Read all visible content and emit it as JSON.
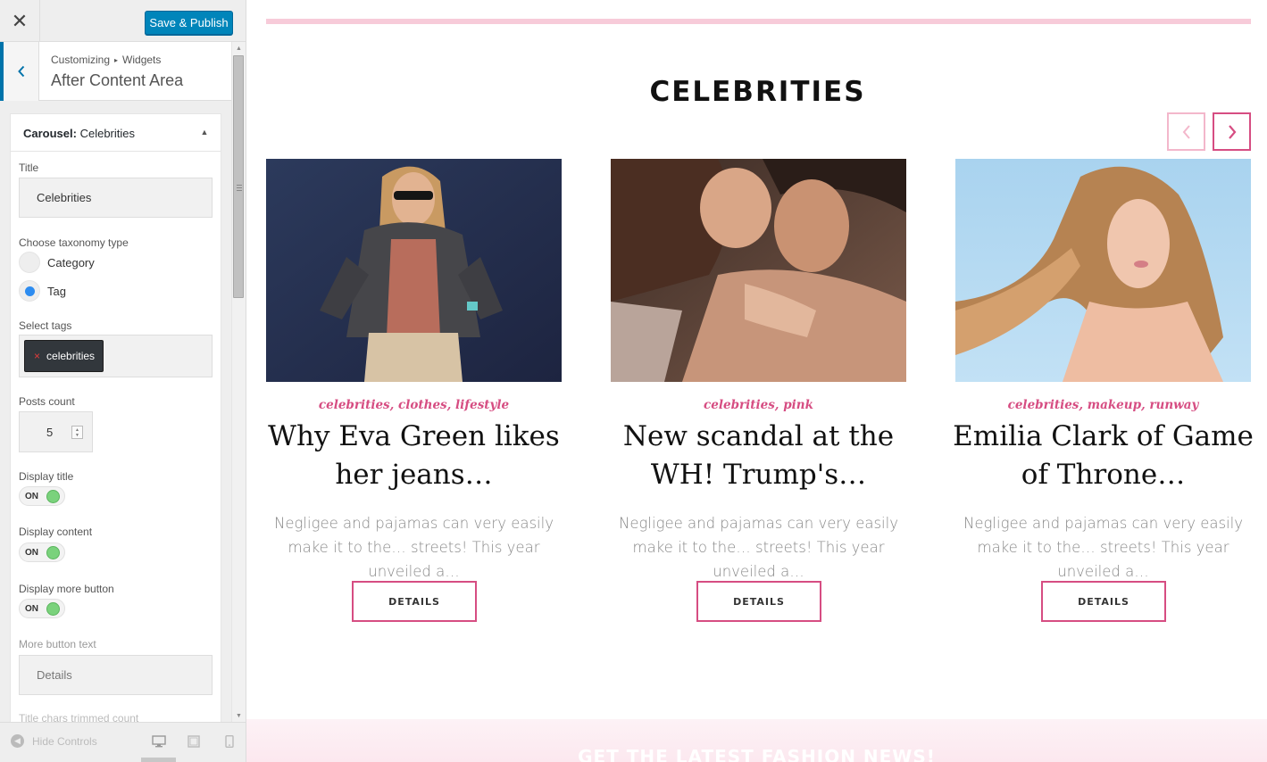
{
  "toolbar": {
    "close_icon": "close-icon",
    "publish_label": "Save & Publish",
    "accent": "#0085ba"
  },
  "section": {
    "breadcrumb_root": "Customizing",
    "breadcrumb_current": "Widgets",
    "title": "After Content Area"
  },
  "widget": {
    "title_prefix": "Carousel:",
    "title_name": "Celebrities",
    "fields": {
      "title_label": "Title",
      "title_value": "Celebrities",
      "taxonomy_label": "Choose taxonomy type",
      "taxonomy_options": [
        {
          "label": "Category",
          "checked": false
        },
        {
          "label": "Tag",
          "checked": true
        }
      ],
      "tags_label": "Select tags",
      "selected_tag": "celebrities",
      "tag_remove": "×",
      "posts_count_label": "Posts count",
      "posts_count_value": "5",
      "display_title_label": "Display title",
      "display_title_state": "ON",
      "display_content_label": "Display content",
      "display_content_state": "ON",
      "display_more_label": "Display more button",
      "display_more_state": "ON",
      "more_text_label": "More button text",
      "more_text_value": "Details",
      "title_chars_label": "Title chars trimmed count"
    }
  },
  "footer": {
    "hide_controls": "Hide Controls",
    "devices": [
      "desktop-icon",
      "tablet-icon",
      "mobile-icon"
    ]
  },
  "preview": {
    "heading": "CELEBRITIES",
    "accent": "#d64d82",
    "cards": [
      {
        "tags": "celebrities, clothes, lifestyle",
        "title": "Why Eva Green likes her jeans…",
        "excerpt": "Negligee and pajamas can very easily make it to the… streets! This year unveiled a…",
        "button": "DETAILS"
      },
      {
        "tags": "celebrities, pink",
        "title": "New scandal at the WH! Trump's…",
        "excerpt": "Negligee and pajamas can very easily make it to the… streets! This year unveiled a…",
        "button": "DETAILS"
      },
      {
        "tags": "celebrities, makeup, runway",
        "title": "Emilia Clark of Game of Throne…",
        "excerpt": "Negligee and pajamas can very easily make it to the… streets! This year unveiled a…",
        "button": "DETAILS"
      }
    ],
    "newsletter": "GET THE LATEST FASHION NEWS!"
  }
}
